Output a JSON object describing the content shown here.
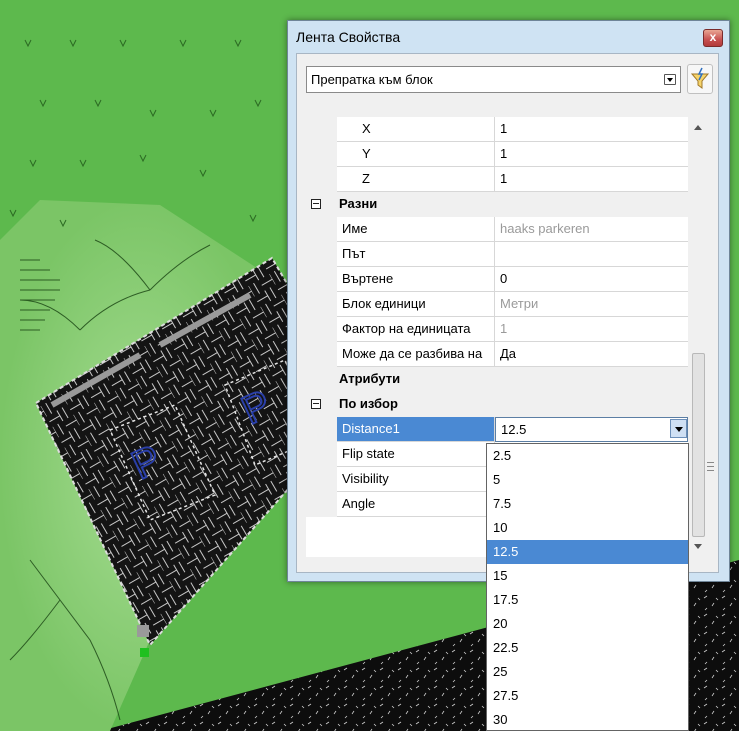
{
  "window": {
    "title": "Лента Свойства",
    "close_glyph": "x",
    "selector_value": "Препратка към блок",
    "filter_icon": "quick-select-icon"
  },
  "properties": {
    "rows": [
      {
        "label": "X",
        "value": "1"
      },
      {
        "label": "Y",
        "value": "1"
      },
      {
        "label": "Z",
        "value": "1"
      }
    ],
    "misc_category": "Разни",
    "misc": [
      {
        "label": "Име",
        "value": "haaks parkeren"
      },
      {
        "label": "Път",
        "value": ""
      },
      {
        "label": "Въртене",
        "value": "0"
      },
      {
        "label": "Блок единици",
        "value": "Метри"
      },
      {
        "label": "Фактор на единицата",
        "value": "1"
      },
      {
        "label": "Може да се разбива на",
        "value": "Да"
      }
    ],
    "attributes_category": "Атрибути",
    "custom_category": "По избор",
    "custom": [
      {
        "label": "Distance1",
        "value": "12.5"
      },
      {
        "label": "Flip state",
        "value": ""
      },
      {
        "label": "Visibility",
        "value": ""
      },
      {
        "label": "Angle",
        "value": ""
      }
    ]
  },
  "dropdown": {
    "options": [
      "2.5",
      "5",
      "7.5",
      "10",
      "12.5",
      "15",
      "17.5",
      "20",
      "22.5",
      "25",
      "27.5",
      "30"
    ],
    "selected": "12.5"
  },
  "drawing": {
    "parking_labels": [
      "P",
      "P"
    ],
    "colors": {
      "lawn": "#58b548",
      "lawn_light": "#8ed27a",
      "paving": "#141414",
      "parking_sign": "#2a3fa8",
      "selection": "#4a89d3"
    }
  }
}
